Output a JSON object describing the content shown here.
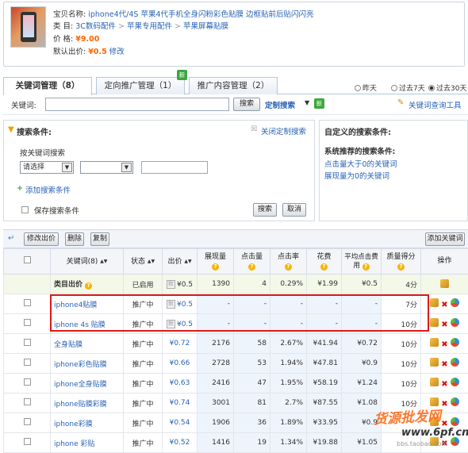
{
  "product": {
    "name_label": "宝贝名称:",
    "name": "iphone4代/4S 苹果4代手机全身闪粉彩色贴膜 边框贴前后贴闪闪亮",
    "category_label": "类 目:",
    "category": [
      "3C数码配件",
      "苹果专用配件",
      "苹果屏幕贴膜"
    ],
    "price_label": "价 格:",
    "price": "¥9.00",
    "default_bid_label": "默认出价:",
    "default_bid": "¥0.5",
    "modify_link": "修改"
  },
  "tabs": [
    {
      "label": "关键词管理（8）",
      "active": true
    },
    {
      "label": "定向推广管理（1）",
      "active": false
    },
    {
      "label": "推广内容管理（2）",
      "active": false
    }
  ],
  "new_badge": "新",
  "date_options": [
    {
      "label": "昨天",
      "selected": false
    },
    {
      "label": "过去7天",
      "selected": false
    },
    {
      "label": "过去30天",
      "selected": true
    }
  ],
  "keyword_search": {
    "label": "关键词:",
    "value": "",
    "search_button": "搜索",
    "custom_search": "定制搜索",
    "new_badge": "新",
    "tool_link": "关键词查询工具"
  },
  "search_conditions": {
    "title": "搜索条件:",
    "close_link": "关闭定制搜索",
    "search_by": "按关键词搜索",
    "select1": "请选择",
    "select2": "",
    "value": "",
    "add_condition": "添加搜索条件",
    "save_label": "保存搜索条件",
    "search_button": "搜索",
    "cancel_button": "取消"
  },
  "custom_conditions": {
    "title": "自定义的搜索条件:",
    "system_title": "系统推荐的搜索条件:",
    "links": [
      "点击量大于0的关键词",
      "展现量为0的关键词"
    ]
  },
  "toolbar": {
    "modify_bid": "修改出价",
    "delete": "删除",
    "copy": "复制",
    "add_keyword": "添加关键词"
  },
  "table": {
    "headers": [
      "关键词(8)",
      "状态",
      "出价",
      "展现量",
      "点击量",
      "点击率",
      "花费",
      "平均点击费用",
      "质量得分",
      "操作"
    ],
    "category_row": {
      "keyword": "类目出价",
      "status": "已启用",
      "bid": "¥0.5",
      "impressions": "1390",
      "clicks": "4",
      "ctr": "0.29%",
      "cost": "¥1.99",
      "avg_cpc": "¥0.5",
      "score": "4分"
    },
    "rows": [
      {
        "keyword": "iphone4贴膜",
        "status": "推广中",
        "bid": "¥0.5",
        "default": true,
        "impressions": "-",
        "clicks": "-",
        "ctr": "-",
        "cost": "-",
        "avg_cpc": "-",
        "score": "7分"
      },
      {
        "keyword": "iphone 4s 贴膜",
        "status": "推广中",
        "bid": "¥0.5",
        "default": true,
        "impressions": "-",
        "clicks": "-",
        "ctr": "-",
        "cost": "-",
        "avg_cpc": "-",
        "score": "10分"
      },
      {
        "keyword": "全身贴膜",
        "status": "推广中",
        "bid": "¥0.72",
        "default": false,
        "impressions": "2176",
        "clicks": "58",
        "ctr": "2.67%",
        "cost": "¥41.94",
        "avg_cpc": "¥0.72",
        "score": "10分"
      },
      {
        "keyword": "iphone彩色贴膜",
        "status": "推广中",
        "bid": "¥0.66",
        "default": false,
        "impressions": "2728",
        "clicks": "53",
        "ctr": "1.94%",
        "cost": "¥47.81",
        "avg_cpc": "¥0.9",
        "score": "10分"
      },
      {
        "keyword": "iphone全身贴膜",
        "status": "推广中",
        "bid": "¥0.63",
        "default": false,
        "impressions": "2416",
        "clicks": "47",
        "ctr": "1.95%",
        "cost": "¥58.19",
        "avg_cpc": "¥1.24",
        "score": "10分"
      },
      {
        "keyword": "iphone贴膜彩膜",
        "status": "推广中",
        "bid": "¥0.74",
        "default": false,
        "impressions": "3001",
        "clicks": "81",
        "ctr": "2.7%",
        "cost": "¥87.55",
        "avg_cpc": "¥1.08",
        "score": "10分"
      },
      {
        "keyword": "iphone彩膜",
        "status": "推广中",
        "bid": "¥0.54",
        "default": false,
        "impressions": "1906",
        "clicks": "36",
        "ctr": "1.89%",
        "cost": "¥33.95",
        "avg_cpc": "¥0.9",
        "score": ""
      },
      {
        "keyword": "iphone 彩贴",
        "status": "推广中",
        "bid": "¥0.52",
        "default": false,
        "impressions": "1416",
        "clicks": "19",
        "ctr": "1.34%",
        "cost": "¥19.88",
        "avg_cpc": "¥1.05",
        "score": ""
      }
    ]
  },
  "watermark": {
    "line1": "货源批发网",
    "line2": "www.6pf.cn",
    "line3": "bbs.taobao.com"
  },
  "colors": {
    "link": "#2a63b5",
    "price": "#ff6600",
    "highlight": "#e01919",
    "new_badge": "#3aa83a"
  }
}
